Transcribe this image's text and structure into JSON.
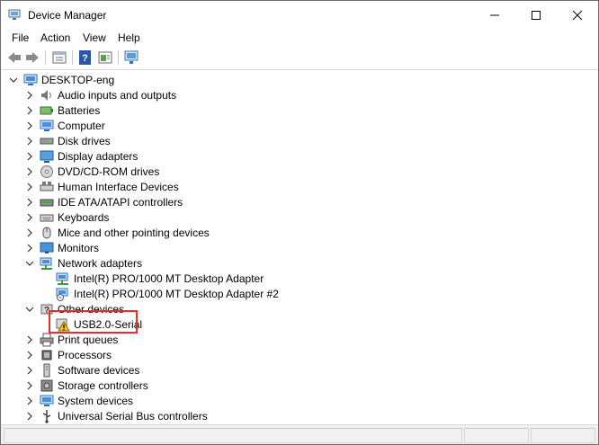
{
  "window": {
    "title": "Device Manager",
    "controls": {
      "minimize": "minimize",
      "maximize": "maximize",
      "close": "close"
    }
  },
  "menu": [
    "File",
    "Action",
    "View",
    "Help"
  ],
  "toolbar": [
    "back-icon",
    "forward-icon",
    "properties-icon",
    "help-icon",
    "show-hidden-icon",
    "scan-hardware-icon"
  ],
  "tree": {
    "root": "DESKTOP-eng",
    "categories": [
      {
        "label": "Audio inputs and outputs",
        "icon": "speaker-icon",
        "expanded": false
      },
      {
        "label": "Batteries",
        "icon": "battery-icon",
        "expanded": false
      },
      {
        "label": "Computer",
        "icon": "computer-icon",
        "expanded": false
      },
      {
        "label": "Disk drives",
        "icon": "disk-drive-icon",
        "expanded": false
      },
      {
        "label": "Display adapters",
        "icon": "display-adapter-icon",
        "expanded": false
      },
      {
        "label": "DVD/CD-ROM drives",
        "icon": "dvd-icon",
        "expanded": false
      },
      {
        "label": "Human Interface Devices",
        "icon": "hid-icon",
        "expanded": false
      },
      {
        "label": "IDE ATA/ATAPI controllers",
        "icon": "ide-icon",
        "expanded": false
      },
      {
        "label": "Keyboards",
        "icon": "keyboard-icon",
        "expanded": false
      },
      {
        "label": "Mice and other pointing devices",
        "icon": "mouse-icon",
        "expanded": false
      },
      {
        "label": "Monitors",
        "icon": "monitor-icon",
        "expanded": false
      },
      {
        "label": "Network adapters",
        "icon": "network-icon",
        "expanded": true,
        "children": [
          "Intel(R) PRO/1000 MT Desktop Adapter",
          "Intel(R) PRO/1000 MT Desktop Adapter #2"
        ]
      },
      {
        "label": "Other devices",
        "icon": "other-devices-icon",
        "expanded": true,
        "children": [
          "USB2.0-Serial"
        ]
      },
      {
        "label": "Print queues",
        "icon": "printer-icon",
        "expanded": false
      },
      {
        "label": "Processors",
        "icon": "processor-icon",
        "expanded": false
      },
      {
        "label": "Software devices",
        "icon": "software-device-icon",
        "expanded": false
      },
      {
        "label": "Storage controllers",
        "icon": "storage-icon",
        "expanded": false
      },
      {
        "label": "System devices",
        "icon": "system-devices-icon",
        "expanded": false
      },
      {
        "label": "Universal Serial Bus controllers",
        "icon": "usb-icon",
        "expanded": false
      }
    ]
  },
  "colors": {
    "highlight_border": "#e0302d",
    "warning": "#f2c200",
    "icon_blue": "#2b6fc2"
  }
}
